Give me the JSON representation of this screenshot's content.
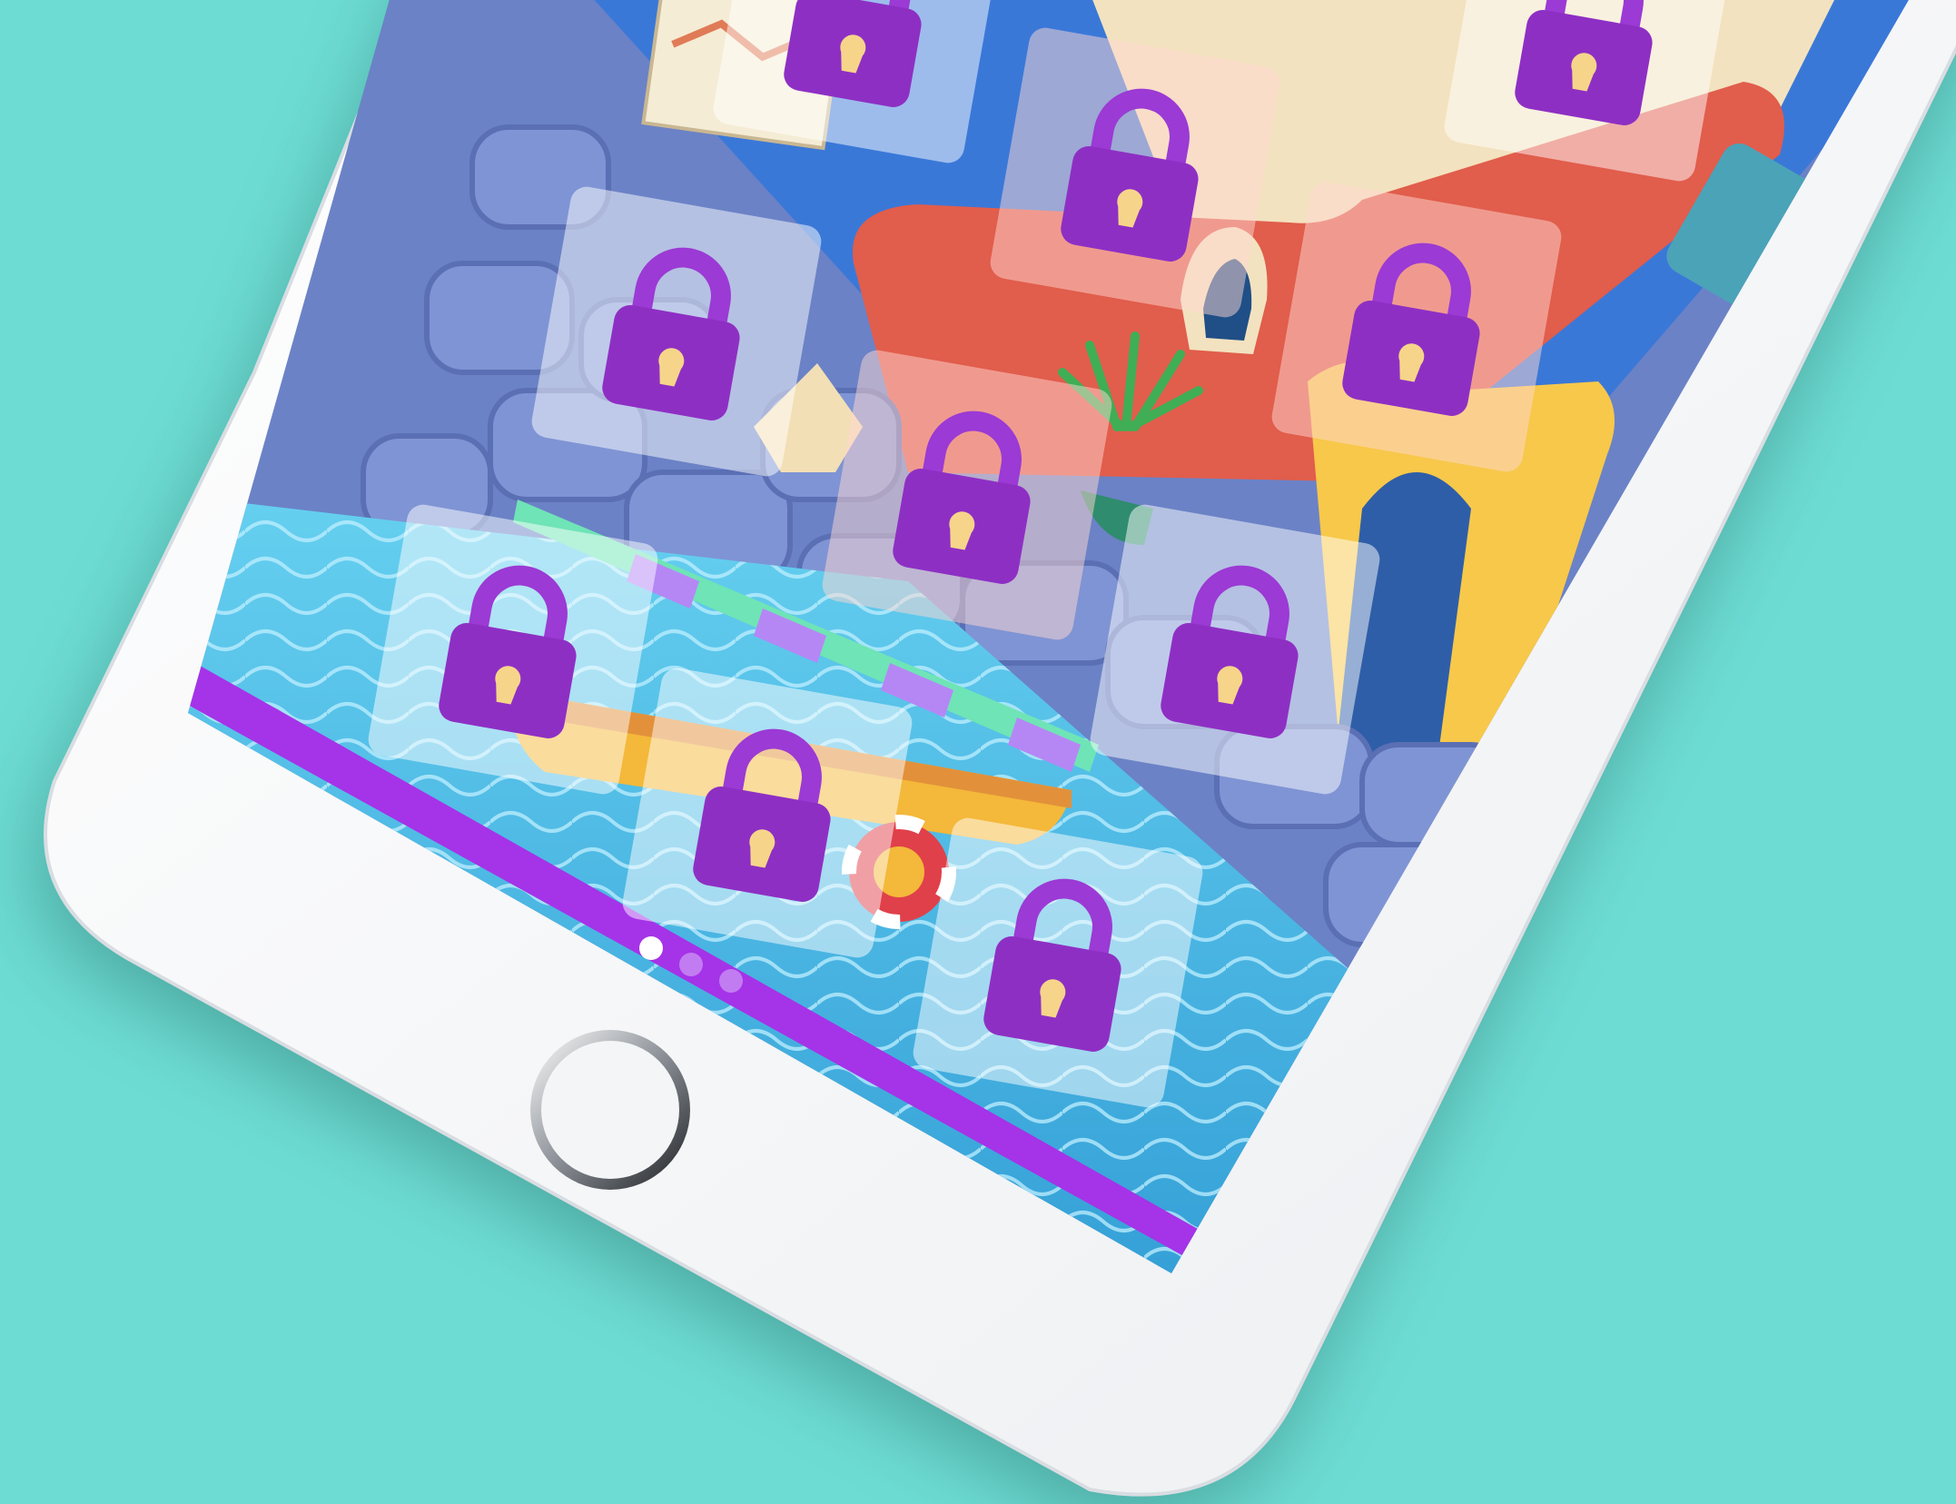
{
  "colors": {
    "background": "#6ddcd3",
    "phone_body": "#f3f4f6",
    "phone_edge": "#d9dde2",
    "accent_purple": "#a533e8",
    "lock_purple": "#8e2fc4",
    "lock_shackle": "#9b3ad4",
    "tile_tint": "#ffffff",
    "water": "#49b8e6",
    "stone": "#6f84c8",
    "wall_red": "#e15d4c",
    "wall_yellow": "#f7c84a",
    "sand": "#f3e2bf"
  },
  "app": {
    "screen": "level-select",
    "levels": [
      {
        "state": "locked",
        "icon": "padlock-icon"
      },
      {
        "state": "locked",
        "icon": "padlock-icon"
      },
      {
        "state": "locked",
        "icon": "padlock-icon"
      },
      {
        "state": "locked",
        "icon": "padlock-icon"
      },
      {
        "state": "locked",
        "icon": "padlock-icon"
      },
      {
        "state": "locked",
        "icon": "padlock-icon"
      },
      {
        "state": "locked",
        "icon": "padlock-icon"
      },
      {
        "state": "locked",
        "icon": "padlock-icon"
      },
      {
        "state": "locked",
        "icon": "padlock-icon"
      },
      {
        "state": "locked",
        "icon": "padlock-icon"
      }
    ],
    "pagination": {
      "total": 3,
      "active": 1
    }
  },
  "device": {
    "home_button": "home-button"
  }
}
